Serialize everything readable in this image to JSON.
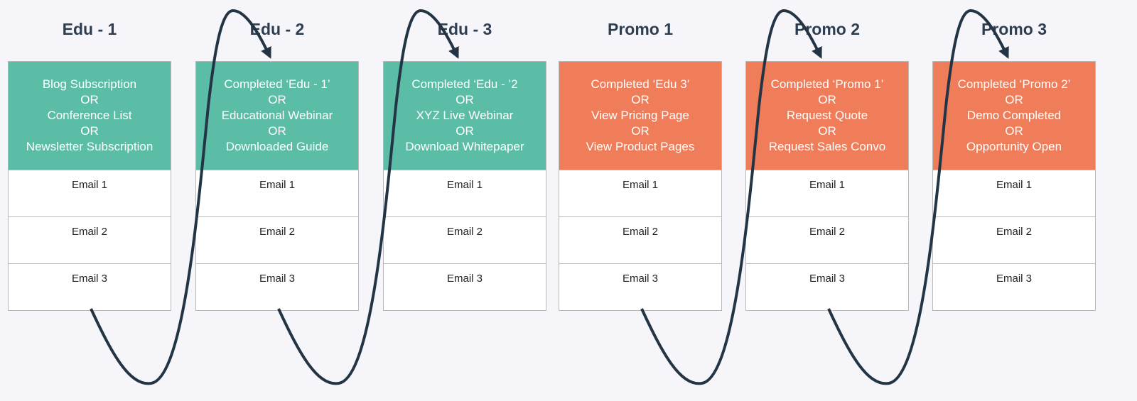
{
  "colors": {
    "edu": "#5bbda5",
    "promo": "#ef7d5a",
    "arrow": "#233445"
  },
  "stages": [
    {
      "title": "Edu - 1",
      "type": "edu",
      "triggers": [
        "Blog Subscription",
        "OR",
        "Conference List",
        "OR",
        "Newsletter Subscription"
      ],
      "emails": [
        "Email 1",
        "Email 2",
        "Email 3"
      ]
    },
    {
      "title": "Edu - 2",
      "type": "edu",
      "triggers": [
        "Completed ‘Edu - 1’",
        "OR",
        "Educational Webinar",
        "OR",
        "Downloaded Guide"
      ],
      "emails": [
        "Email 1",
        "Email 2",
        "Email 3"
      ]
    },
    {
      "title": "Edu - 3",
      "type": "edu",
      "triggers": [
        "Completed ‘Edu - ’2",
        "OR",
        "XYZ Live Webinar",
        "OR",
        "Download Whitepaper"
      ],
      "emails": [
        "Email 1",
        "Email 2",
        "Email 3"
      ]
    },
    {
      "title": "Promo 1",
      "type": "promo",
      "triggers": [
        "Completed ‘Edu 3’",
        "OR",
        "View Pricing Page",
        "OR",
        "View Product Pages"
      ],
      "emails": [
        "Email 1",
        "Email 2",
        "Email 3"
      ]
    },
    {
      "title": "Promo 2",
      "type": "promo",
      "triggers": [
        "Completed ‘Promo 1’",
        "OR",
        "Request Quote",
        "OR",
        "Request Sales Convo"
      ],
      "emails": [
        "Email 1",
        "Email 2",
        "Email 3"
      ]
    },
    {
      "title": "Promo 3",
      "type": "promo",
      "triggers": [
        "Completed ‘Promo 2’",
        "OR",
        "Demo Completed",
        "OR",
        "Opportunity Open"
      ],
      "emails": [
        "Email 1",
        "Email 2",
        "Email 3"
      ]
    }
  ],
  "connections": [
    [
      0,
      1
    ],
    [
      1,
      2
    ],
    [
      3,
      4
    ],
    [
      4,
      5
    ]
  ]
}
